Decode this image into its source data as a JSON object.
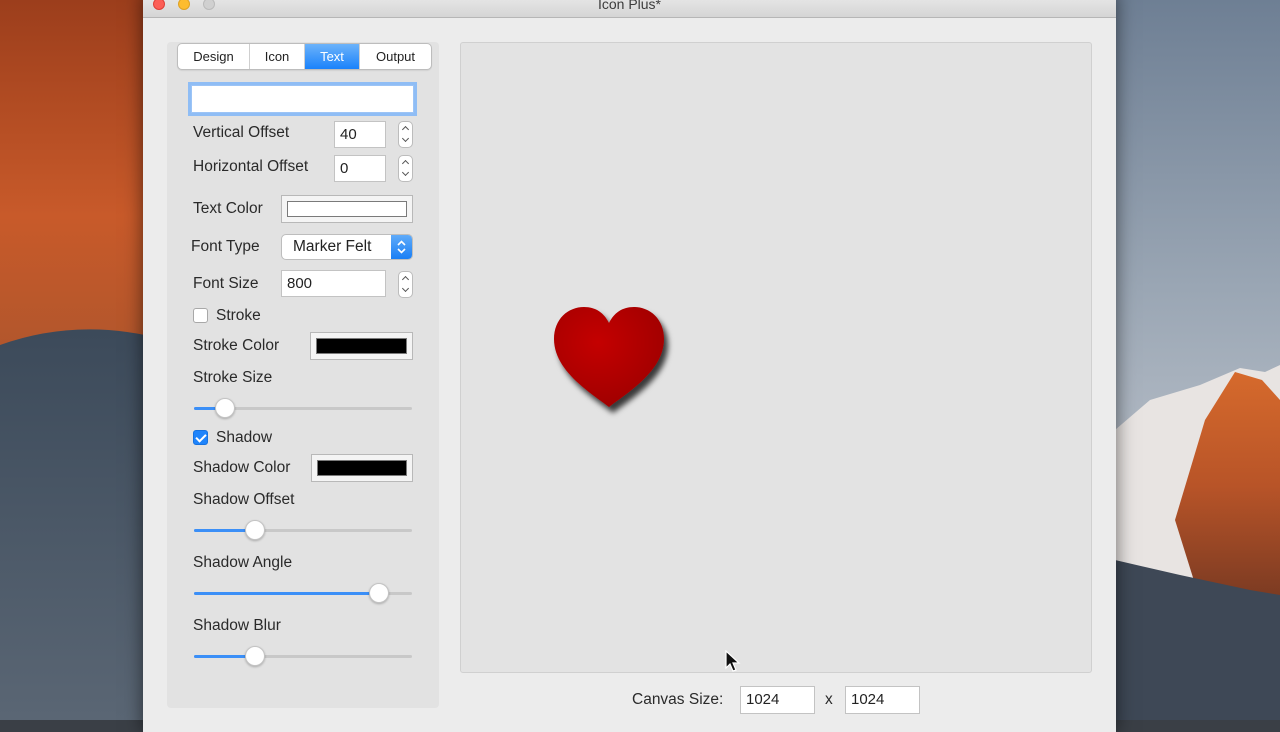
{
  "window": {
    "title": "Icon Plus*"
  },
  "tabs": [
    {
      "label": "Design",
      "active": false
    },
    {
      "label": "Icon",
      "active": false
    },
    {
      "label": "Text",
      "active": true
    },
    {
      "label": "Output",
      "active": false
    }
  ],
  "text_panel": {
    "text_value": "",
    "vertical_offset": {
      "label": "Vertical Offset",
      "value": "40"
    },
    "horizontal_offset": {
      "label": "Horizontal Offset",
      "value": "0"
    },
    "text_color": {
      "label": "Text Color",
      "color": "#ffffff"
    },
    "font_type": {
      "label": "Font Type",
      "value": "Marker Felt"
    },
    "font_size": {
      "label": "Font Size",
      "value": "800"
    },
    "stroke": {
      "label": "Stroke",
      "checked": false
    },
    "stroke_color": {
      "label": "Stroke Color",
      "color": "#000000"
    },
    "stroke_size": {
      "label": "Stroke Size",
      "level": 0.14
    },
    "shadow": {
      "label": "Shadow",
      "checked": true
    },
    "shadow_color": {
      "label": "Shadow Color",
      "color": "#000000"
    },
    "shadow_offset": {
      "label": "Shadow Offset",
      "level": 0.28
    },
    "shadow_angle": {
      "label": "Shadow Angle",
      "level": 0.85
    },
    "shadow_blur": {
      "label": "Shadow Blur",
      "level": 0.28
    }
  },
  "preview": {
    "icon": "heart-icon",
    "heart_color": "#b10000"
  },
  "canvas_size": {
    "label": "Canvas Size:",
    "width": "1024",
    "separator": "x",
    "height": "1024"
  },
  "accent_color": "#1f84fb"
}
